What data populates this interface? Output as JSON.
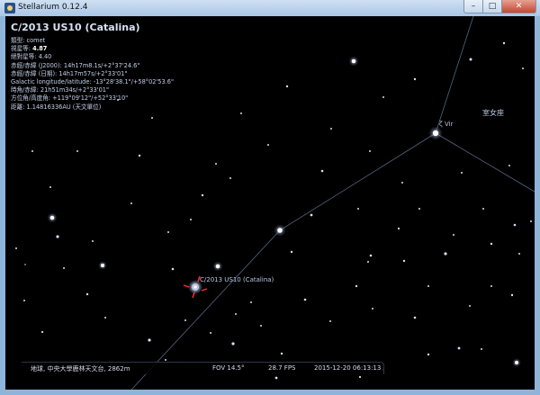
{
  "window": {
    "title": "Stellarium 0.12.4",
    "controls": {
      "minimize": "–",
      "maximize": "□",
      "close": "✕"
    }
  },
  "object_info": {
    "name": "C/2013 US10 (Catalina)",
    "type": "類型: comet",
    "magnitude_label": "視星等: ",
    "magnitude_value": "4.87",
    "absolute_magnitude": "絕對星等: 4.40",
    "ra_dec_j2000": "赤經/赤緯 (J2000): 14h17m8.1s/+2°37'24.6\"",
    "ra_dec_date": "赤經/赤緯 (日期): 14h17m57s/+2°33'01\"",
    "galactic": "Galactic longitude/latitude: -13°28'38.1\"/+58°02'53.6\"",
    "hour_angle": "時角/赤緯: 21h51m34s/+2°33'01\"",
    "az_alt": "方位角/高度角: +119°09'12\"/+52°33'10\"",
    "distance": "距離: 1.14816336AU (天文單位)"
  },
  "sky_labels": {
    "target": "C/2013 US10 (Catalina)",
    "zeta_vir": "ζ Vir",
    "constellation": "室女座"
  },
  "bottom_bar": {
    "location": "地球, 中央大學鹿林天文台, 2862m",
    "fov": "FOV 14.5°",
    "fps": "28.7 FPS",
    "date_time": "2015-12-20   06:13:13"
  },
  "colors": {
    "sky": "#000000",
    "constellation_line": "#55657f",
    "marker": "#e8262a",
    "text": "#c3cfe6"
  }
}
